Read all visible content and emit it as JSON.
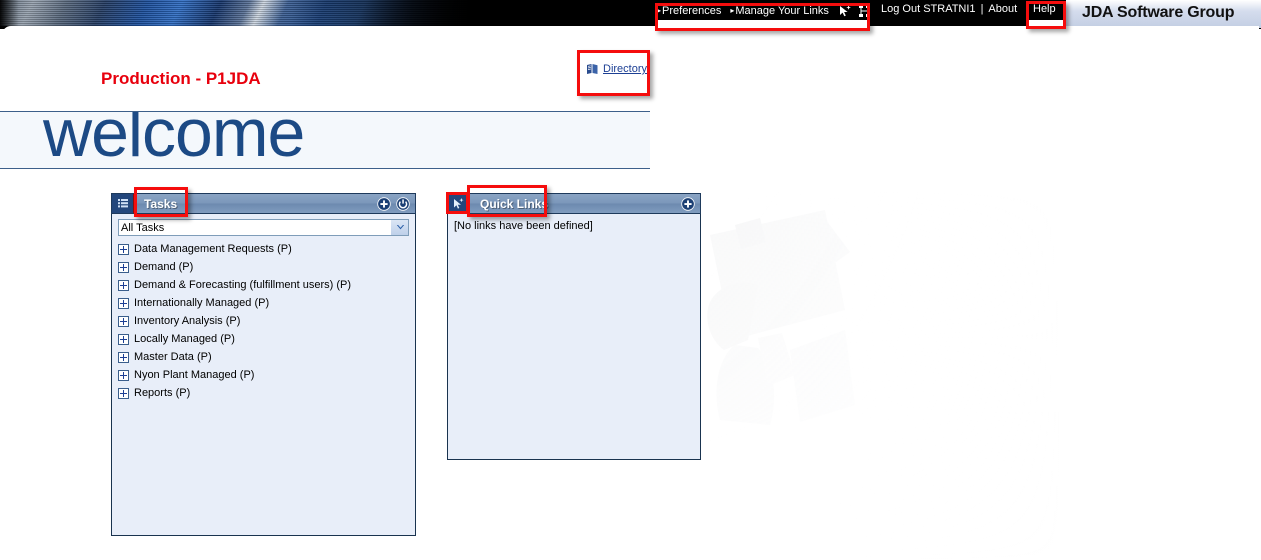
{
  "header": {
    "nav_left": [
      {
        "label": "Preferences",
        "arrow": true,
        "name": "preferences-link"
      },
      {
        "label": "Manage Your Links",
        "arrow": true,
        "name": "manage-your-links-link"
      }
    ],
    "nav_icons": [
      {
        "name": "pointer-star-icon"
      },
      {
        "name": "link-node-icon"
      }
    ],
    "logout_label": "Log Out STRATNI1",
    "separator": "|",
    "about_label": "About",
    "help_label": "Help",
    "brand": "JDA Software Group"
  },
  "page": {
    "environment_title": "Production - P1JDA",
    "directory_label": "Directory",
    "welcome_text": "welcome"
  },
  "tasks_portlet": {
    "title": "Tasks",
    "filter_value": "All Tasks",
    "filter_options": [
      "All Tasks"
    ],
    "add_button_title": "Add",
    "power_button_title": "Refresh",
    "items": [
      {
        "label": "Data Management Requests (P)"
      },
      {
        "label": "Demand (P)"
      },
      {
        "label": "Demand & Forecasting (fulfillment users) (P)"
      },
      {
        "label": "Internationally Managed (P)"
      },
      {
        "label": "Inventory Analysis (P)"
      },
      {
        "label": "Locally Managed (P)"
      },
      {
        "label": "Master Data (P)"
      },
      {
        "label": "Nyon Plant Managed (P)"
      },
      {
        "label": "Reports (P)"
      }
    ]
  },
  "quicklinks_portlet": {
    "title": "Quick Links",
    "add_button_title": "Add",
    "empty_message": "[No links have been defined]"
  },
  "colors": {
    "brand_red": "#e8000d",
    "link_blue": "#1c3f94",
    "welcome_blue": "#1c4a85",
    "portlet_header": "#7b97ba",
    "portlet_body": "#e8eef9",
    "annotation_red": "#f50d0d"
  }
}
